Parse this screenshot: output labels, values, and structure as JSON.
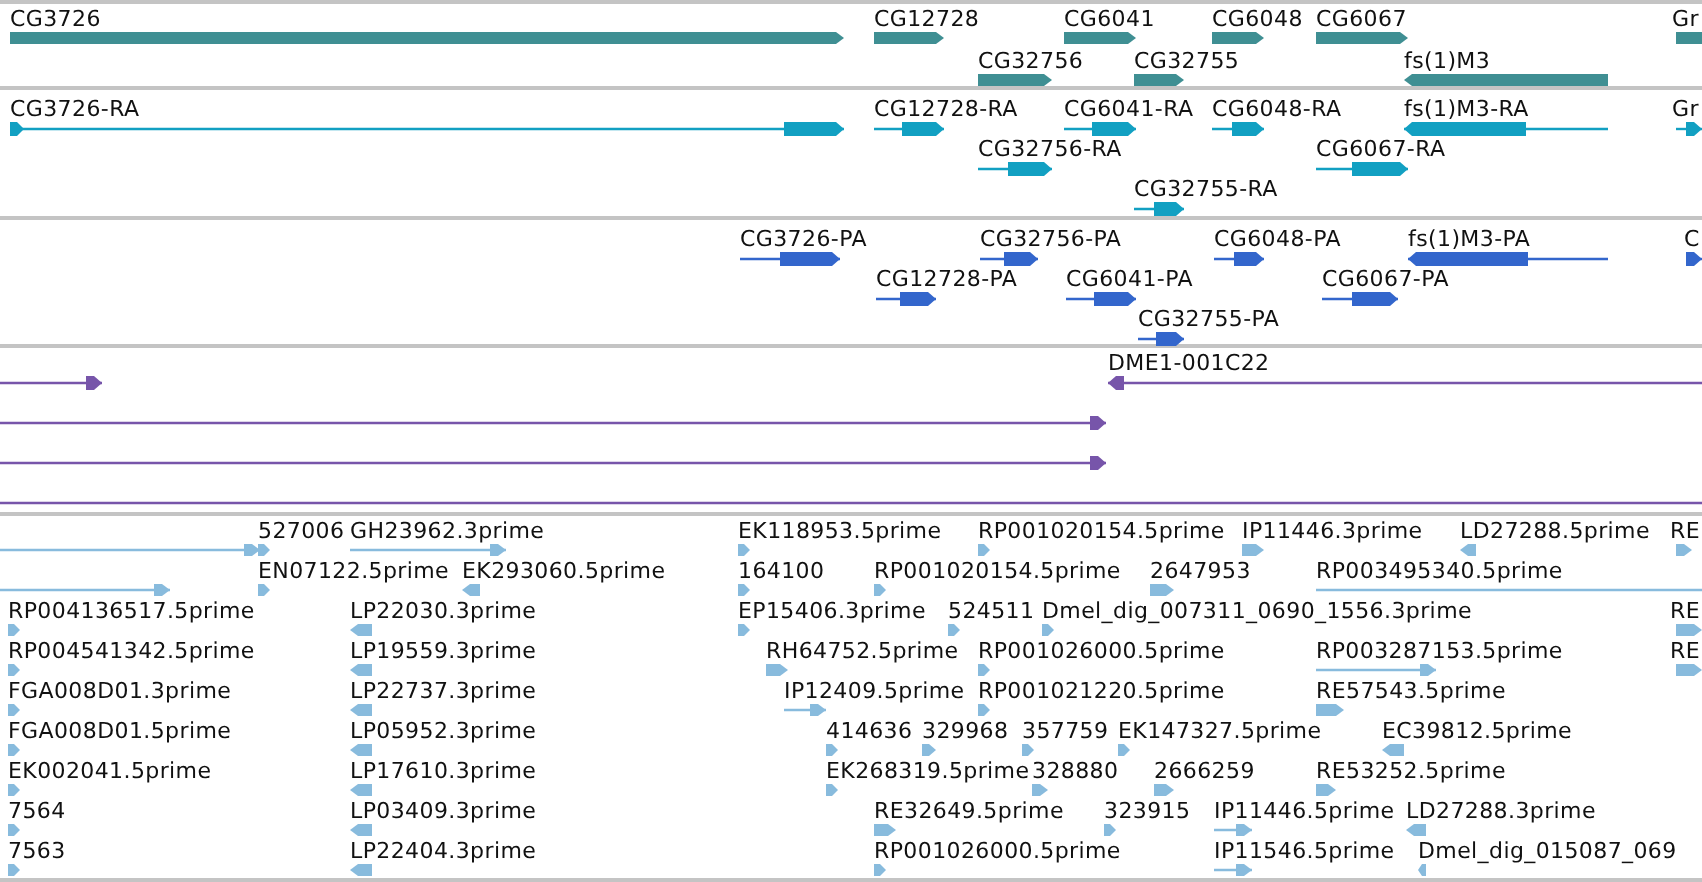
{
  "tracks": [
    {
      "kind": "gene",
      "rows": [
        [
          {
            "label": "CG3726",
            "reverse": false
          },
          {
            "label": "CG12728",
            "reverse": false
          },
          {
            "label": "CG6041",
            "reverse": false
          },
          {
            "label": "CG6048",
            "reverse": false
          },
          {
            "label": "CG6067",
            "reverse": false
          },
          {
            "label": "Gr"
          }
        ],
        [
          {
            "label": "CG32756",
            "reverse": false
          },
          {
            "label": "CG32755",
            "reverse": false
          },
          {
            "label": "fs(1)M3",
            "reverse": true
          }
        ]
      ]
    },
    {
      "kind": "transcript",
      "rows": [
        [
          {
            "label": "CG3726-RA",
            "reverse": false
          },
          {
            "label": "CG12728-RA",
            "reverse": false
          },
          {
            "label": "CG6041-RA",
            "reverse": false
          },
          {
            "label": "CG6048-RA",
            "reverse": false
          },
          {
            "label": "fs(1)M3-RA",
            "reverse": true
          },
          {
            "label": "Gr",
            "reverse": false
          }
        ],
        [
          {
            "label": "CG32756-RA",
            "reverse": false
          },
          {
            "label": "CG6067-RA",
            "reverse": false
          }
        ],
        [
          {
            "label": "CG32755-RA",
            "reverse": false
          }
        ]
      ]
    },
    {
      "kind": "protein",
      "rows": [
        [
          {
            "label": "CG3726-PA",
            "reverse": false
          },
          {
            "label": "CG32756-PA",
            "reverse": false
          },
          {
            "label": "CG6048-PA",
            "reverse": false
          },
          {
            "label": "fs(1)M3-PA",
            "reverse": true
          },
          {
            "label": "C",
            "reverse": false
          }
        ],
        [
          {
            "label": "CG12728-PA",
            "reverse": false
          },
          {
            "label": "CG6041-PA",
            "reverse": false
          },
          {
            "label": "CG6067-PA",
            "reverse": false
          }
        ],
        [
          {
            "label": "CG32755-PA",
            "reverse": false
          }
        ]
      ]
    },
    {
      "kind": "clone",
      "rows": [
        [
          {
            "reverse": false
          },
          {
            "label": "DME1-001C22",
            "reverse": true
          }
        ],
        [
          {
            "reverse": false
          }
        ],
        [
          {
            "reverse": false
          }
        ],
        [
          {}
        ]
      ]
    },
    {
      "kind": "est",
      "rows": [
        [
          {
            "reverse": false
          },
          {
            "label": "527006",
            "reverse": false
          },
          {
            "label": "GH23962.3prime",
            "reverse": false
          },
          {
            "label": "EK118953.5prime",
            "reverse": false
          },
          {
            "label": "RP001020154.5prime",
            "reverse": false
          },
          {
            "label": "IP11446.3prime",
            "reverse": false
          },
          {
            "label": "LD27288.5prime",
            "reverse": true
          },
          {
            "label": "RE",
            "reverse": false
          }
        ],
        [
          {
            "reverse": false
          },
          {
            "label": "EN07122.5prime",
            "reverse": false
          },
          {
            "label": "EK293060.5prime",
            "reverse": true
          },
          {
            "label": "164100",
            "reverse": false
          },
          {
            "label": "RP001020154.5prime",
            "reverse": false
          },
          {
            "label": "2647953",
            "reverse": false
          },
          {
            "label": "RP003495340.5prime"
          }
        ],
        [
          {
            "label": "RP004136517.5prime",
            "reverse": false
          },
          {
            "label": "LP22030.3prime",
            "reverse": true
          },
          {
            "label": "EP15406.3prime",
            "reverse": false
          },
          {
            "label": "524511",
            "reverse": false
          },
          {
            "label": "Dmel_dig_007311_0690_1556.3prime",
            "reverse": false
          },
          {
            "label": "RE",
            "reverse": false
          }
        ],
        [
          {
            "label": "RP004541342.5prime",
            "reverse": false
          },
          {
            "label": "LP19559.3prime",
            "reverse": true
          },
          {
            "label": "RH64752.5prime",
            "reverse": false
          },
          {
            "label": "RP001026000.5prime",
            "reverse": false
          },
          {
            "label": "RP003287153.5prime",
            "reverse": false
          },
          {
            "label": "RE",
            "reverse": false
          }
        ],
        [
          {
            "label": "FGA008D01.3prime",
            "reverse": false
          },
          {
            "label": "LP22737.3prime",
            "reverse": true
          },
          {
            "label": "IP12409.5prime",
            "reverse": false
          },
          {
            "label": "RP001021220.5prime",
            "reverse": false
          },
          {
            "label": "RE57543.5prime",
            "reverse": false
          }
        ],
        [
          {
            "label": "FGA008D01.5prime",
            "reverse": false
          },
          {
            "label": "LP05952.3prime",
            "reverse": true
          },
          {
            "label": "414636",
            "reverse": false
          },
          {
            "label": "329968",
            "reverse": false
          },
          {
            "label": "357759",
            "reverse": false
          },
          {
            "label": "EK147327.5prime",
            "reverse": false
          },
          {
            "label": "EC39812.5prime",
            "reverse": true
          }
        ],
        [
          {
            "label": "EK002041.5prime",
            "reverse": false
          },
          {
            "label": "LP17610.3prime",
            "reverse": true
          },
          {
            "label": "EK268319.5prime",
            "reverse": false
          },
          {
            "label": "328880",
            "reverse": false
          },
          {
            "label": "2666259",
            "reverse": false
          },
          {
            "label": "RE53252.5prime",
            "reverse": false
          }
        ],
        [
          {
            "label": "7564",
            "reverse": false
          },
          {
            "label": "LP03409.3prime",
            "reverse": true
          },
          {
            "label": "RE32649.5prime",
            "reverse": false
          },
          {
            "label": "323915",
            "reverse": false
          },
          {
            "label": "IP11446.5prime",
            "reverse": false
          },
          {
            "label": "LD27288.3prime",
            "reverse": true
          }
        ],
        [
          {
            "label": "7563",
            "reverse": false
          },
          {
            "label": "LP22404.3prime",
            "reverse": true
          },
          {
            "label": "RP001026000.5prime",
            "reverse": false
          },
          {
            "label": "IP11546.5prime",
            "reverse": false
          },
          {
            "label": "Dmel_dig_015087_069",
            "reverse": true
          }
        ]
      ]
    }
  ]
}
